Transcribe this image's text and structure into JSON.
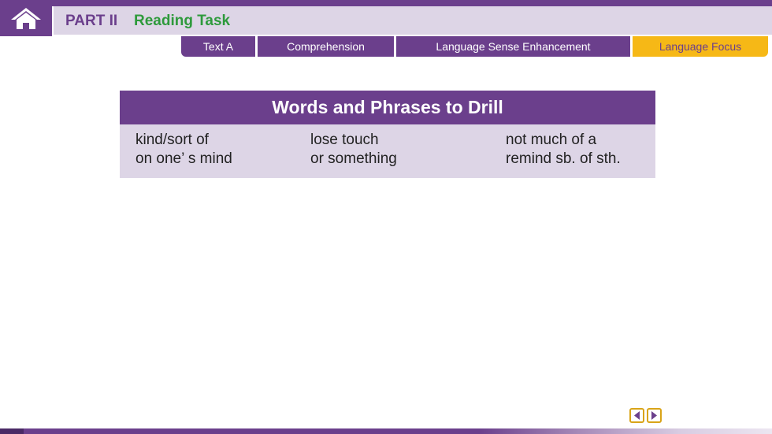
{
  "header": {
    "part": "PART II",
    "task": "Reading Task"
  },
  "tabs": [
    {
      "label": "Text A"
    },
    {
      "label": "Comprehension"
    },
    {
      "label": "Language Sense Enhancement"
    },
    {
      "label": "Language Focus",
      "active": true
    }
  ],
  "table": {
    "title": "Words and Phrases to Drill",
    "columns": [
      [
        "kind/sort of",
        "on one’ s mind"
      ],
      [
        "lose touch",
        "or something"
      ],
      [
        "not much of a",
        "remind sb. of sth."
      ]
    ]
  },
  "icons": {
    "home": "home-icon",
    "prev": "prev-arrow-icon",
    "next": "next-arrow-icon"
  },
  "colors": {
    "primary": "#6b3f8c",
    "light": "#ddd5e6",
    "green": "#2e9a3c",
    "active_tab": "#f6b816"
  }
}
